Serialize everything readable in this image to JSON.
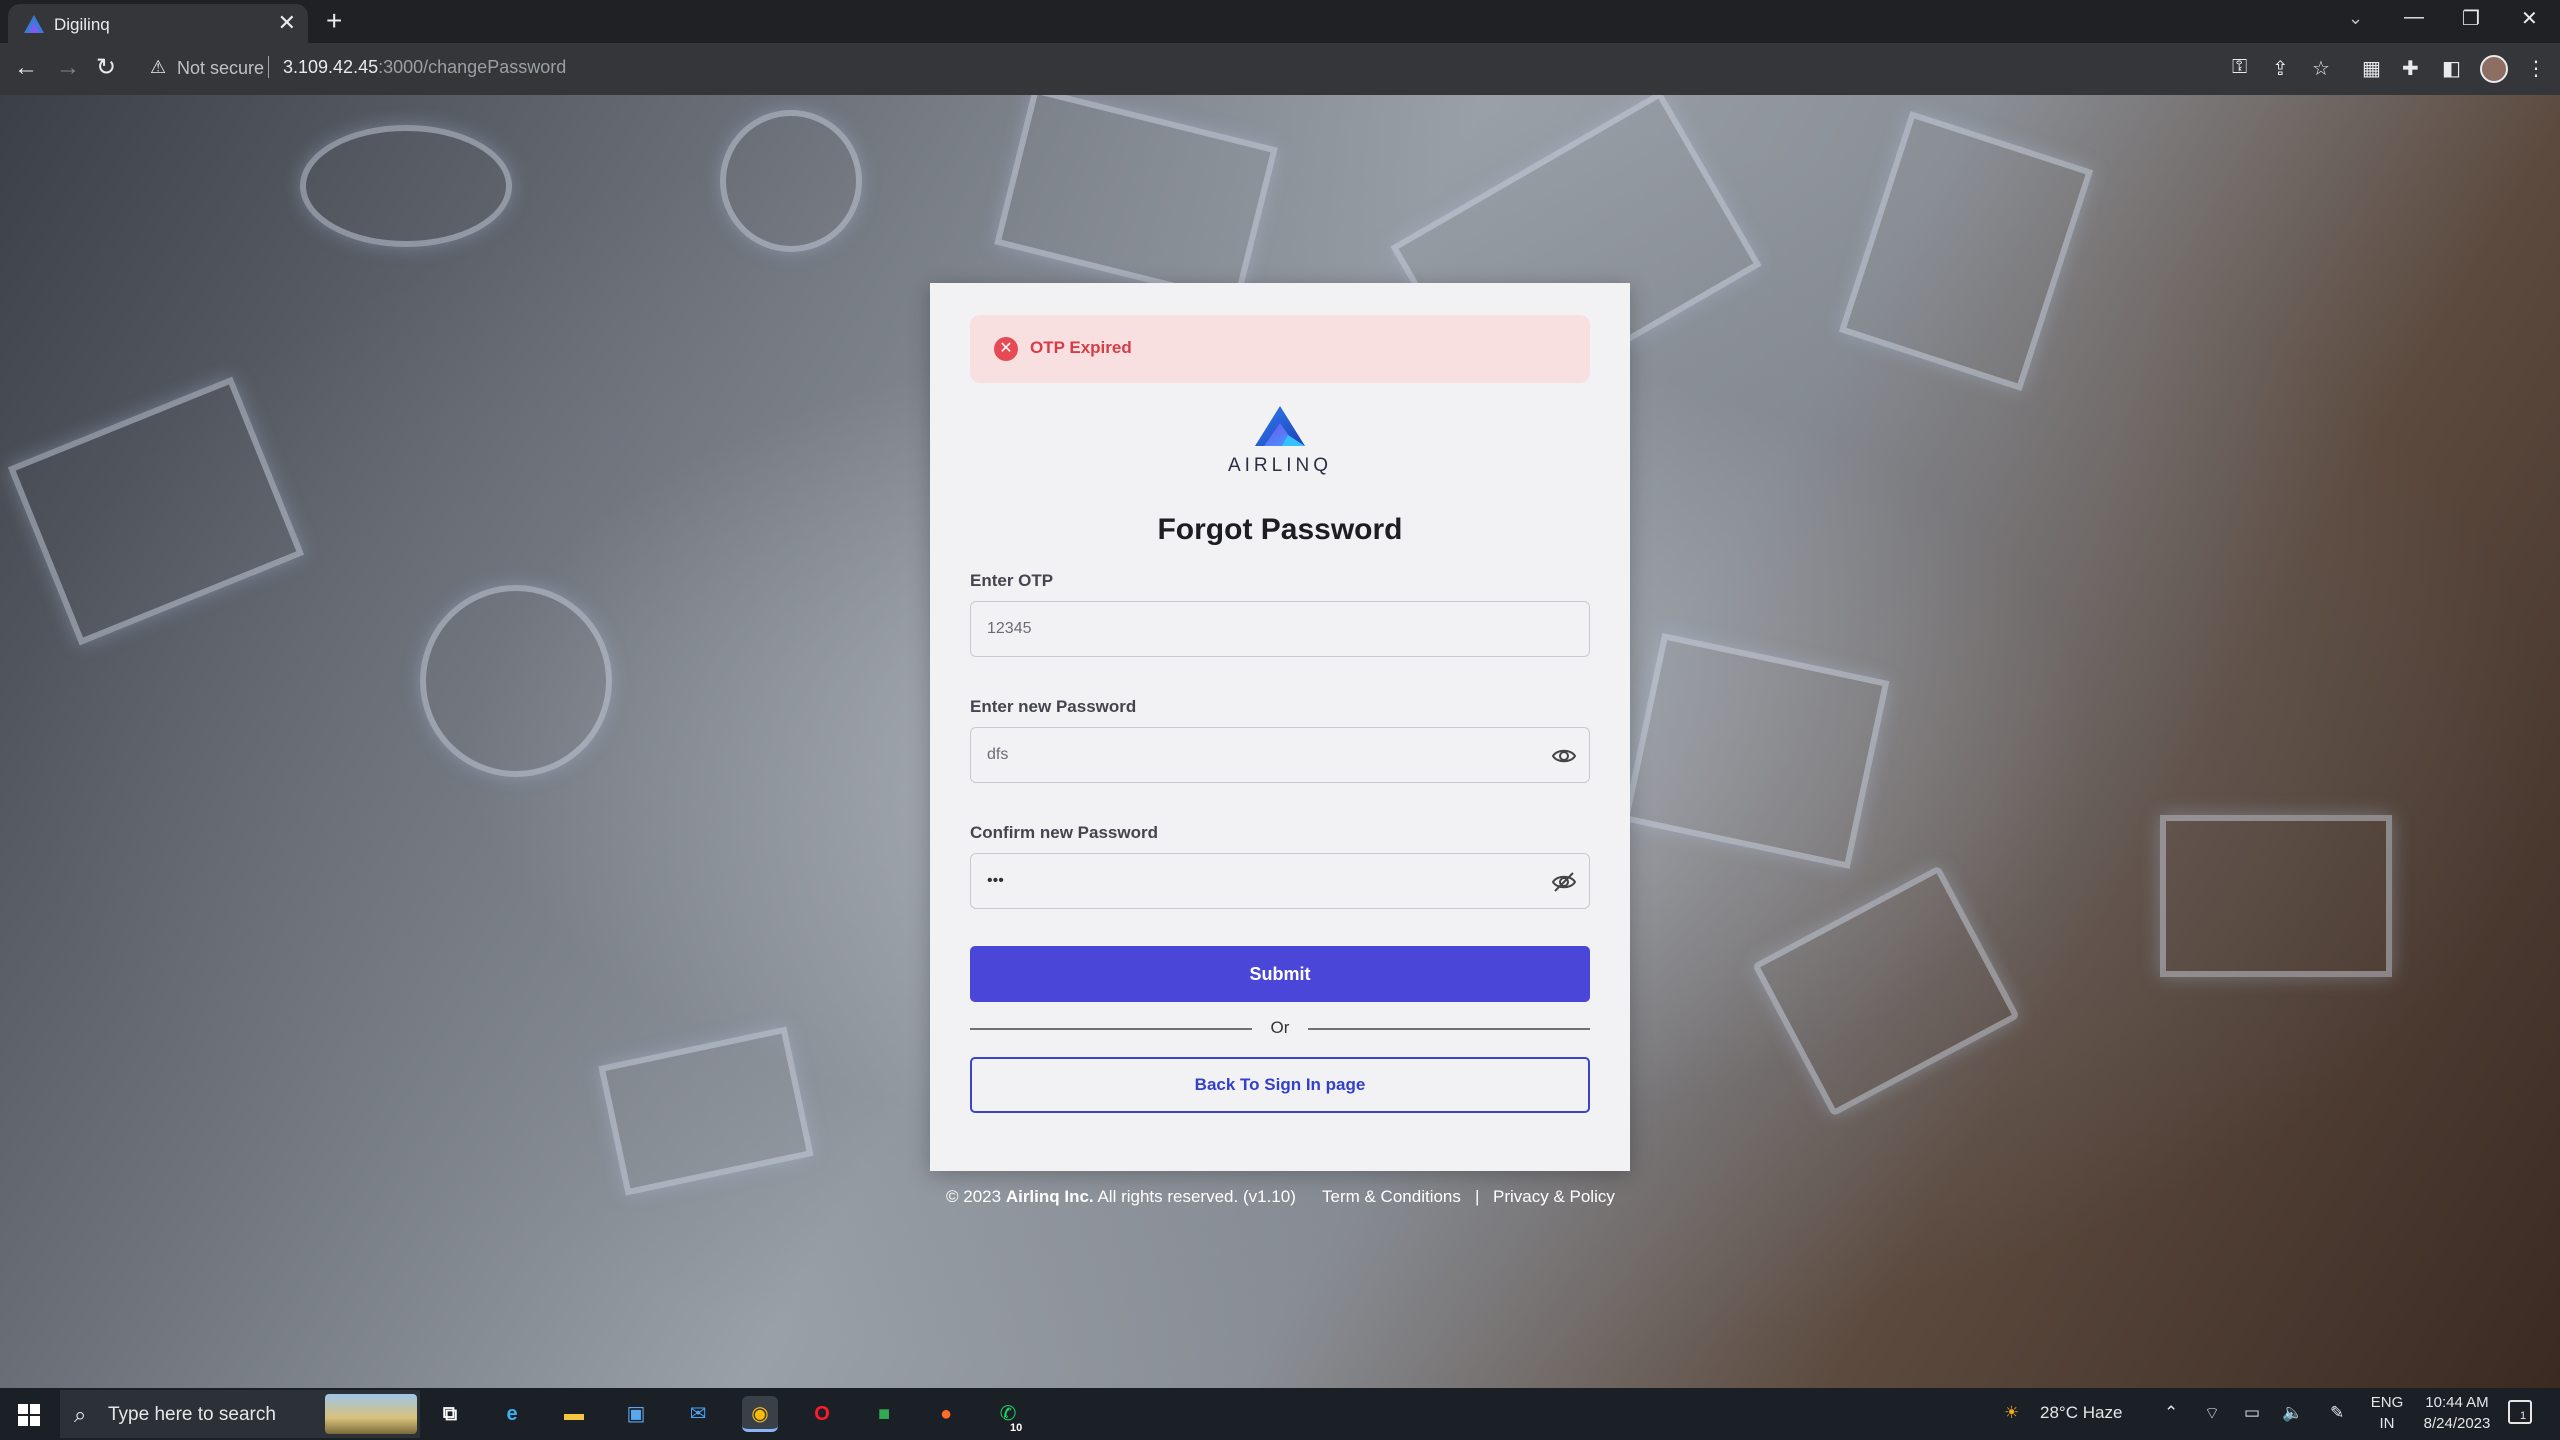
{
  "browser": {
    "tab_title": "Digilinq",
    "tab_close": "✕",
    "new_tab": "+",
    "security_label": "Not secure",
    "url_host": "3.109.42.45",
    "url_path": ":3000/changePassword"
  },
  "alert": {
    "icon": "✕",
    "message": "OTP Expired"
  },
  "logo": {
    "text": "AIRLINQ"
  },
  "form": {
    "title": "Forgot Password",
    "otp_label": "Enter OTP",
    "otp_value": "12345",
    "new_password_label": "Enter new Password",
    "new_password_value": "dfs",
    "confirm_password_label": "Confirm new Password",
    "confirm_password_value": "•••",
    "submit_label": "Submit",
    "or_text": "Or",
    "back_label": "Back To Sign In page"
  },
  "footer": {
    "copyright_prefix": "© 2023",
    "company": "Airlinq Inc.",
    "rights": "All rights reserved. (v1.10)",
    "terms": "Term & Conditions",
    "separator": "|",
    "privacy": "Privacy & Policy"
  },
  "taskbar": {
    "search_placeholder": "Type here to search",
    "whatsapp_badge": "10",
    "weather": "28°C  Haze",
    "language_top": "ENG",
    "language_bottom": "IN",
    "time": "10:44 AM",
    "date": "8/24/2023",
    "notification_count": "1"
  },
  "colors": {
    "primary": "#4a47d8",
    "alert_bg": "#f8e0e1",
    "alert_text": "#d63d47",
    "link": "#3340c8"
  }
}
